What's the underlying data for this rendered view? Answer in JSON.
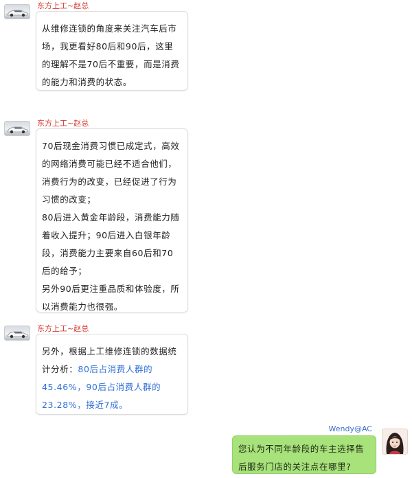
{
  "messages": [
    {
      "sender": "东方上工~赵总",
      "avatar_icon": "car-avatar-icon",
      "paragraphs": [
        "从维修连锁的角度来关注汽车后市场，我更看好80后和90后，这里的理解不是70后不重要，而是消费的能力和消费的状态。"
      ]
    },
    {
      "sender": "东方上工~赵总",
      "avatar_icon": "car-avatar-icon",
      "paragraphs": [
        "70后现金消费习惯已成定式，高效的网络消费可能已经不适合他们，消费行为的改变，已经促进了行为习惯的改变；",
        "80后进入黄金年龄段，消费能力随着收入提升；90后进入白银年龄段，消费能力主要来自60后和70后的给予；",
        "另外90后更注重品质和体验度，所以消费能力也很强。"
      ]
    },
    {
      "sender": "东方上工~赵总",
      "avatar_icon": "car-avatar-icon",
      "text_before": "另外，根据上工维修连锁的数据统计分析：",
      "highlight": "80后占消费人群的45.46%，90后占消费人群的23.28%，接近7成。",
      "highlight_color": "#2f6fd6"
    },
    {
      "sender": "Wendy@AC",
      "avatar_icon": "girl-avatar-icon",
      "text": "您认为不同年龄段的车主选择售后服务门店的关注点在哪里?",
      "bubble_color": "#a8e27a"
    }
  ]
}
